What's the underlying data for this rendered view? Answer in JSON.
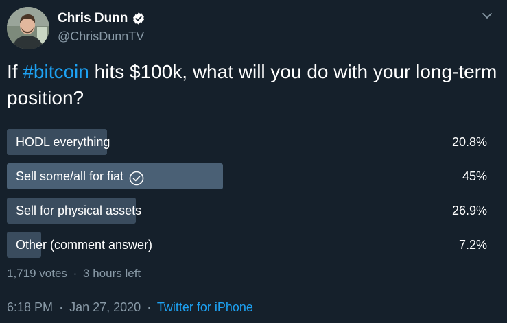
{
  "user": {
    "name": "Chris Dunn",
    "handle": "@ChrisDunnTV"
  },
  "tweet": {
    "text_before": "If ",
    "hashtag": "#bitcoin",
    "text_after": " hits $100k, what will you do with your long-term position?"
  },
  "poll": {
    "options": [
      {
        "label": "HODL everything",
        "percent_text": "20.8%",
        "fraction": 0.208,
        "winner": false
      },
      {
        "label": "Sell some/all for fiat",
        "percent_text": "45%",
        "fraction": 0.45,
        "winner": true
      },
      {
        "label": "Sell for physical assets",
        "percent_text": "26.9%",
        "fraction": 0.269,
        "winner": false
      },
      {
        "label": "Other (comment answer)",
        "percent_text": "7.2%",
        "fraction": 0.072,
        "winner": false
      }
    ],
    "votes": "1,719 votes",
    "separator": "·",
    "time_left": "3 hours left"
  },
  "footer": {
    "time": "6:18 PM",
    "separator": "·",
    "date": "Jan 27, 2020",
    "source": "Twitter for iPhone"
  },
  "icons": {
    "verified": "verified-badge-icon",
    "caret": "chevron-down-icon",
    "check": "check-circle-icon"
  },
  "colors": {
    "background": "#15202b",
    "link": "#1da1f2",
    "muted": "#8899a6",
    "bar": "#3a4c5e",
    "bar_winner": "#4a6075"
  }
}
